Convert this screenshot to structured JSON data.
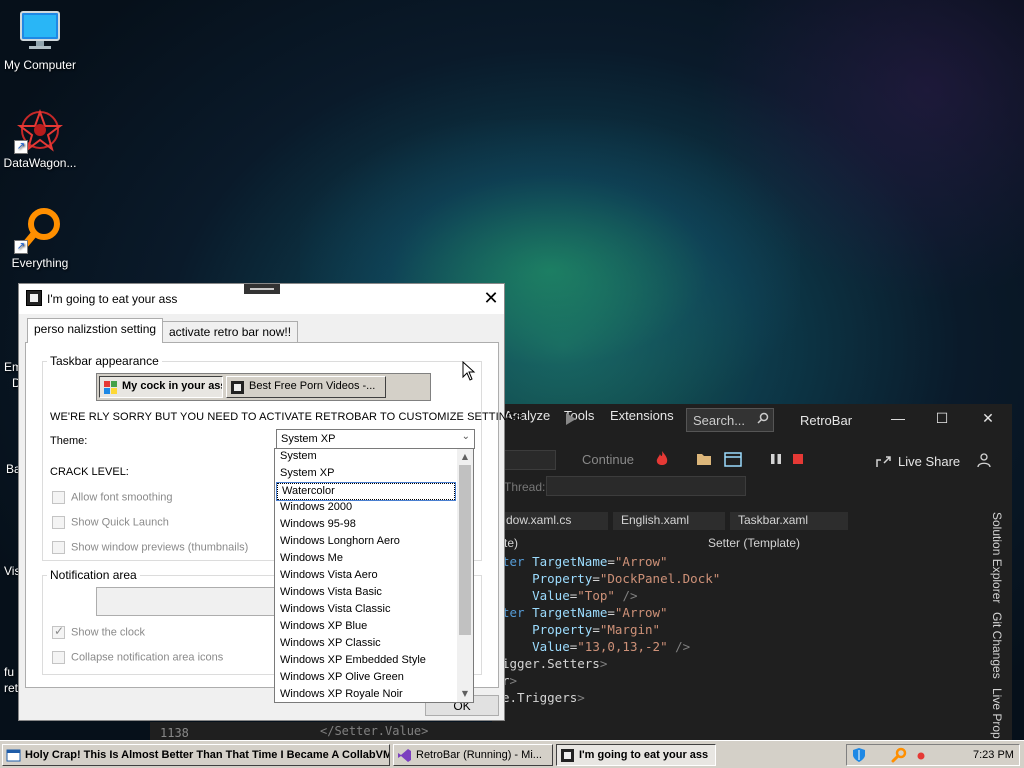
{
  "desktop": {
    "icons": [
      {
        "label": "My Computer",
        "icon": "monitor-icon"
      },
      {
        "label": "DataWagon...",
        "icon": "datawagon-icon"
      },
      {
        "label": "Everything",
        "icon": "search-magnifier-icon"
      }
    ],
    "fragments": [
      "Em",
      "D",
      "Ba",
      "Vis",
      "fu",
      "ret"
    ]
  },
  "vs": {
    "menu": [
      "Analyze",
      "Tools",
      "Extensions"
    ],
    "search_placeholder": "Search...",
    "title": "RetroBar",
    "minimize": "—",
    "maximize": "☐",
    "close": "✕",
    "continue_label": "Continue",
    "live_share": "Live Share",
    "thread_label": "Thread:",
    "tabs": [
      "dow.xaml.cs",
      "English.xaml",
      "Taskbar.xaml"
    ],
    "nav_left": "te)",
    "nav_right": "Setter (Template)",
    "right_labels": [
      "Solution Explorer",
      "Git Changes",
      "Live Prop"
    ],
    "line_number": "1138",
    "code_bottom": "</Setter.Value>"
  },
  "dialog": {
    "title": "I'm going to eat your ass",
    "close": "✕",
    "tabs": [
      "perso nalizstion setting",
      "activate retro bar now!!"
    ],
    "group_taskbar": "Taskbar appearance",
    "preview_buttons": [
      "My cock in your ass",
      "Best Free Porn Videos -..."
    ],
    "warning": "WE'RE RLY SORRY BUT YOU NEED TO ACTIVATE RETROBAR TO CUSTOMIZE SETTINGS",
    "theme_label": "Theme:",
    "theme_value": "System XP",
    "crack_label": "CRACK LEVEL:",
    "checkboxes": [
      {
        "label": "Allow font smoothing",
        "checked": false
      },
      {
        "label": "Show Quick Launch",
        "checked": false
      },
      {
        "label": "Show window previews (thumbnails)",
        "checked": false
      }
    ],
    "group_notification": "Notification area",
    "notif_checkboxes": [
      {
        "label": "Show the clock",
        "checked": true
      },
      {
        "label": "Collapse notification area icons",
        "checked": false
      }
    ],
    "ok": "OK"
  },
  "dropdown": {
    "items": [
      "System",
      "System XP",
      "Watercolor",
      "Windows 2000",
      "Windows 95-98",
      "Windows Longhorn Aero",
      "Windows Me",
      "Windows Vista Aero",
      "Windows Vista Basic",
      "Windows Vista Classic",
      "Windows XP Blue",
      "Windows XP Classic",
      "Windows XP Embedded Style",
      "Windows XP Olive Green",
      "Windows XP Royale Noir"
    ],
    "hover_index": 2
  },
  "taskbar": {
    "buttons": [
      {
        "label": "Holy Crap! This Is Almost Better Than That Time I Became A CollabVM!",
        "pressed": false
      },
      {
        "label": "RetroBar (Running) - Mi...",
        "pressed": false
      },
      {
        "label": "I'm going to eat your ass",
        "pressed": true
      }
    ],
    "clock": "7:23 PM"
  }
}
